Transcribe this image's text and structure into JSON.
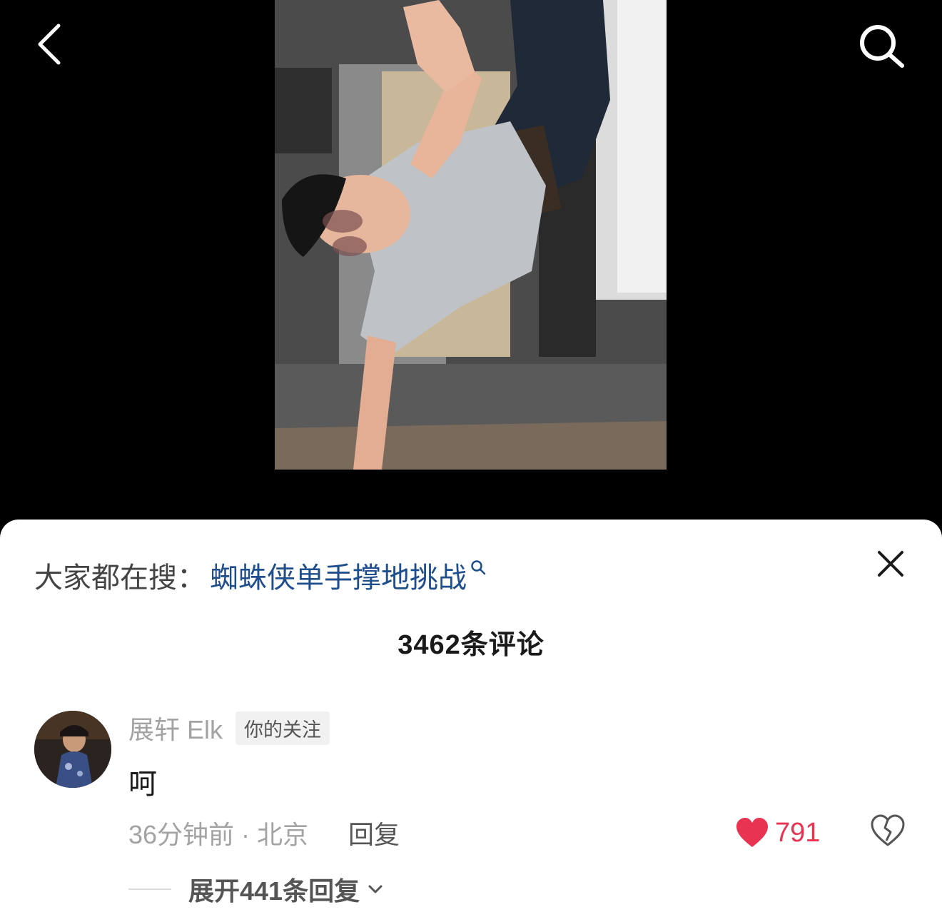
{
  "nav": {
    "back_icon": "chevron-left-icon",
    "search_icon": "search-icon"
  },
  "video": {
    "description": ""
  },
  "sheet": {
    "hot_search_prefix": "大家都在搜：",
    "hot_search_term": "蜘蛛侠单手撑地挑战",
    "close_icon": "close-icon",
    "comment_count_title": "3462条评论"
  },
  "comment": {
    "username": "展轩 Elk",
    "badge": "你的关注",
    "text": "呵",
    "time_location": "36分钟前 · 北京",
    "reply_label": "回复",
    "like_count": "791",
    "like_color": "#e83452",
    "expand_label": "展开441条回复"
  }
}
